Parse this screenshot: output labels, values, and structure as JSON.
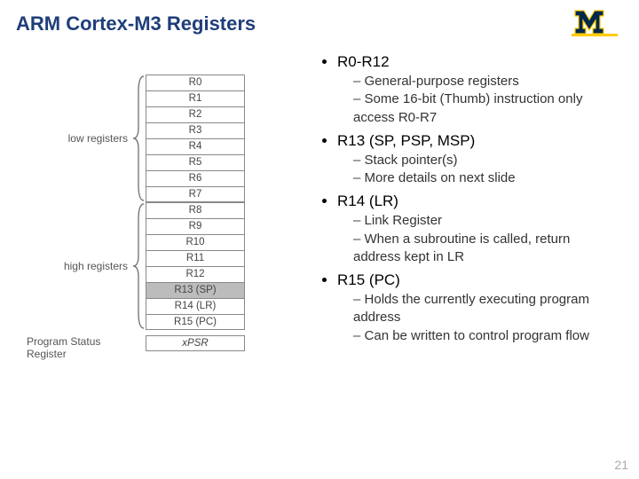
{
  "title": "ARM Cortex-M3 Registers",
  "page_number": "21",
  "figure": {
    "low_label": "low registers",
    "high_label": "high registers",
    "psr_label": "Program Status Register",
    "low_regs": [
      "R0",
      "R1",
      "R2",
      "R3",
      "R4",
      "R5",
      "R6",
      "R7"
    ],
    "high_regs": [
      "R8",
      "R9",
      "R10",
      "R11",
      "R12"
    ],
    "sp": "R13 (SP)",
    "lr": "R14 (LR)",
    "pc": "R15 (PC)",
    "psr": "xPSR"
  },
  "bullets": [
    {
      "head": "R0-R12",
      "subs": [
        "General-purpose registers",
        "Some 16-bit (Thumb) instruction only access R0-R7"
      ]
    },
    {
      "head": "R13 (SP, PSP, MSP)",
      "subs": [
        "Stack pointer(s)",
        "More details on next slide"
      ]
    },
    {
      "head": "R14 (LR)",
      "subs": [
        "Link Register",
        "When a subroutine is called, return address kept in LR"
      ]
    },
    {
      "head": "R15 (PC)",
      "subs": [
        "Holds the currently executing program address",
        "Can be written to control program flow"
      ]
    }
  ]
}
